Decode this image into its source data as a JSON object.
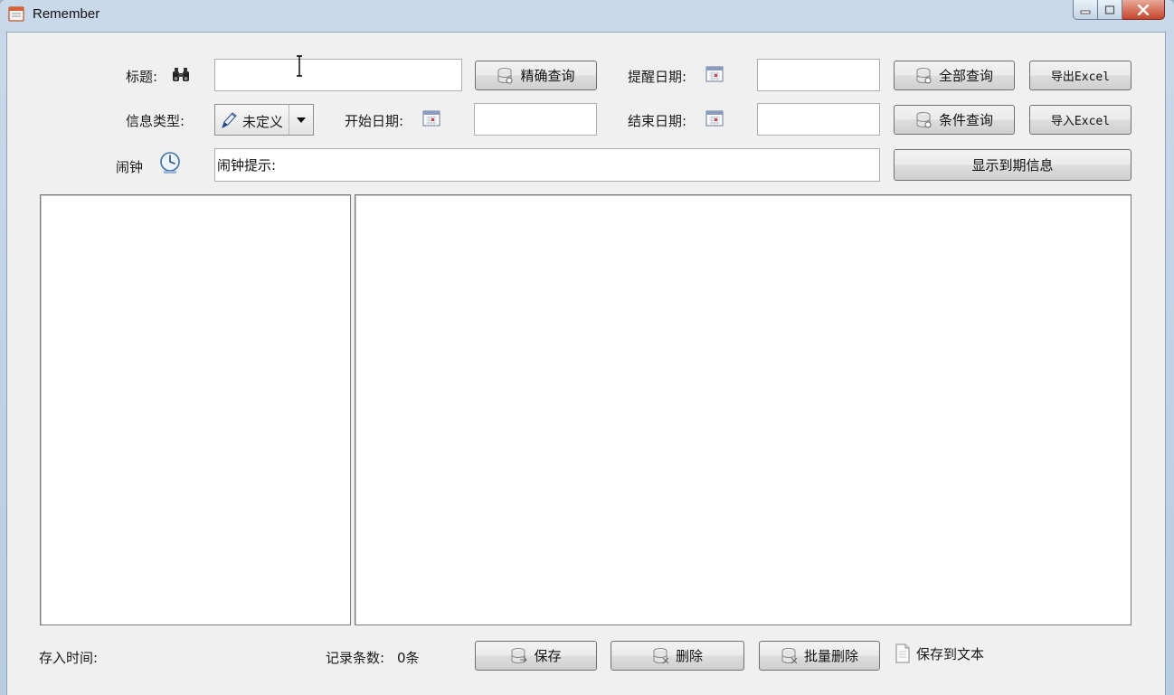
{
  "window": {
    "title": "Remember"
  },
  "form": {
    "title_label": "标题:",
    "title_value": "",
    "exact_query_label": "精确查询",
    "reminder_date_label": "提醒日期:",
    "reminder_date_value": "",
    "all_query_label": "全部查询",
    "export_excel_label": "导出Excel",
    "info_type_label": "信息类型:",
    "info_type_selected": "未定义",
    "start_date_label": "开始日期:",
    "start_date_value": "",
    "end_date_label": "结束日期:",
    "end_date_value": "",
    "condition_query_label": "条件查询",
    "import_excel_label": "导入Excel",
    "alarm_label": "闹钟",
    "alarm_hint_value": "闹钟提示:",
    "show_expired_label": "显示到期信息"
  },
  "footer": {
    "saved_time_label": "存入时间:",
    "record_count_label": "记录条数:",
    "record_count_value": "0条",
    "save_label": "保存",
    "delete_label": "删除",
    "batch_delete_label": "批量删除",
    "save_to_text_label": "保存到文本"
  },
  "icons": {
    "app": "calendar-app-icon",
    "search": "binoculars-icon",
    "database": "database-icon",
    "calendar": "calendar-icon",
    "pen": "pen-icon",
    "clock": "clock-icon",
    "document": "document-icon"
  }
}
